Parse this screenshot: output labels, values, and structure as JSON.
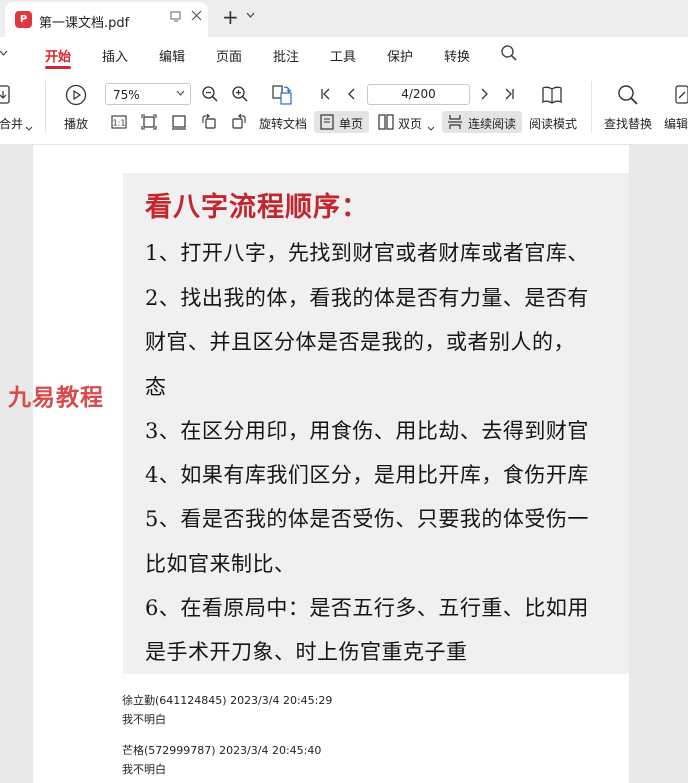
{
  "tab": {
    "app_logo": "P",
    "title": "第一课文档.pdf",
    "window_icon": "restore-icon",
    "close_icon": "close-icon"
  },
  "new_tab": {
    "plus": "+",
    "dropdown": "⌄"
  },
  "menu": {
    "items": [
      "开始",
      "插入",
      "编辑",
      "页面",
      "批注",
      "工具",
      "保护",
      "转换"
    ],
    "active_index": 0,
    "accent_color": "#d7262f"
  },
  "toolbar": {
    "merge_label": "合并",
    "play_label": "播放",
    "zoom_value": "75%",
    "rotate_label": "旋转文档",
    "page_value": "4/200",
    "single_page_label": "单页",
    "double_page_label": "双页",
    "continuous_label": "连续阅读",
    "reading_mode_label": "阅读模式",
    "find_replace_label": "查找替换",
    "edit_label": "编辑"
  },
  "document": {
    "title": "看八字流程顺序：",
    "lines": [
      "1、打开八字，先找到财官或者财库或者官库、",
      "2、找出我的体，看我的体是否有力量、是否有",
      "财官、并且区分体是否是我的，或者别人的，",
      "态",
      "3、在区分用印，用食伤、用比劫、去得到财官",
      "4、如果有库我们区分，是用比开库，食伤开库",
      "5、看是否我的体是否受伤、只要我的体受伤一",
      "比如官来制比、",
      "6、在看原局中：是否五行多、五行重、比如用",
      "是手术开刀象、时上伤官重克子重"
    ],
    "watermark": "九易教程",
    "comments": [
      {
        "meta": "徐立勤(641124845) 2023/3/4 20:45:29",
        "body": "我不明白"
      },
      {
        "meta": "芒格(572999787) 2023/3/4 20:45:40",
        "body": "我不明白"
      }
    ]
  }
}
